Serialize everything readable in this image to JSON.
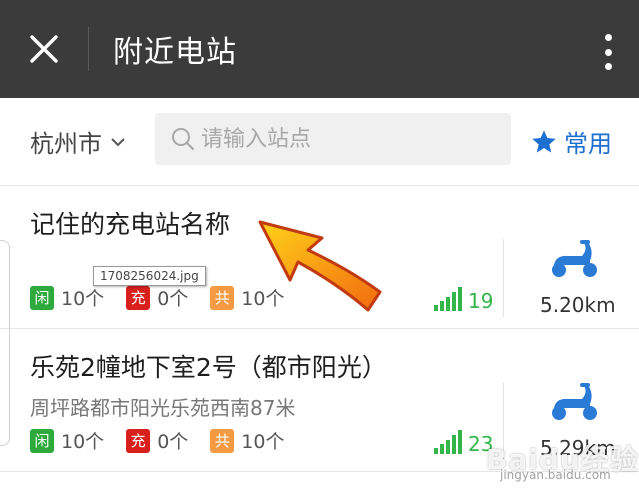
{
  "header": {
    "title": "附近电站",
    "close_icon": "close-icon",
    "more_icon": "more-vertical-icon",
    "background": "#3b3b3b"
  },
  "search": {
    "city": "杭州市",
    "placeholder": "请输入站点",
    "favorites_label": "常用",
    "accent": "#1a6fd1"
  },
  "stations": [
    {
      "name": "记住的充电站名称",
      "address": "",
      "idle_label": "闲",
      "idle_count": "10个",
      "charging_label": "充",
      "charging_count": "0个",
      "shared_label": "共",
      "shared_count": "10个",
      "signal": "19",
      "distance": "5.20km"
    },
    {
      "name": "乐苑2幢地下室2号（都市阳光）",
      "address": "周坪路都市阳光乐苑西南87米",
      "idle_label": "闲",
      "idle_count": "10个",
      "charging_label": "充",
      "charging_count": "0个",
      "shared_label": "共",
      "shared_count": "10个",
      "signal": "23",
      "distance": "5.29km"
    }
  ],
  "colors": {
    "idle": "#2eaa3d",
    "charging": "#d8201c",
    "shared": "#f39a43",
    "signal": "#33b54a",
    "scooter": "#2a7bd6"
  },
  "overlay": {
    "tooltip": "1708256024.jpg",
    "watermark": "Baidu经验",
    "watermark_url": "jingyan.baidu.com"
  }
}
